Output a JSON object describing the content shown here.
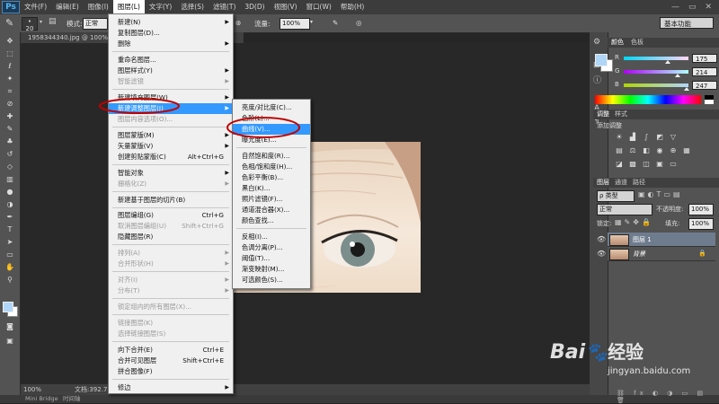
{
  "app": {
    "logo": "Ps"
  },
  "menubar": {
    "items": [
      "文件(F)",
      "编辑(E)",
      "图像(I)",
      "图层(L)",
      "文字(Y)",
      "选择(S)",
      "滤镜(T)",
      "3D(D)",
      "视图(V)",
      "窗口(W)",
      "帮助(H)"
    ],
    "window_buttons": [
      "—",
      "▭",
      "✕"
    ]
  },
  "options_bar": {
    "brush_size": "20",
    "mode_label": "模式:",
    "mode_value": "正常",
    "opacity_label": "不透明度:",
    "opacity_value": "100%",
    "flow_label": "流量:",
    "flow_value": "100%",
    "workspace": "基本功能"
  },
  "document": {
    "tab_title": "1958344340.jpg @ 100% (图层 1, RGB/8) *",
    "status_zoom": "100%",
    "status_doc": "文档:392.7K"
  },
  "bottom_tabs": [
    "Mini Bridge",
    "时间轴"
  ],
  "layer_menu": {
    "items": [
      {
        "label": "新建(N)",
        "arrow": true
      },
      {
        "label": "复制图层(D)..."
      },
      {
        "label": "删除",
        "arrow": true
      },
      {
        "sep": true
      },
      {
        "label": "重命名图层..."
      },
      {
        "label": "图层样式(Y)",
        "arrow": true
      },
      {
        "label": "智能滤镜",
        "disabled": true,
        "arrow": true
      },
      {
        "sep": true
      },
      {
        "label": "新建填充图层(W)",
        "arrow": true
      },
      {
        "label": "新建调整图层(J)",
        "arrow": true,
        "highlight": true
      },
      {
        "label": "图层内容选项(O)...",
        "disabled": true
      },
      {
        "sep": true
      },
      {
        "label": "图层蒙版(M)",
        "arrow": true
      },
      {
        "label": "矢量蒙版(V)",
        "arrow": true
      },
      {
        "label": "创建剪贴蒙版(C)",
        "shortcut": "Alt+Ctrl+G"
      },
      {
        "sep": true
      },
      {
        "label": "智能对象",
        "arrow": true
      },
      {
        "label": "栅格化(Z)",
        "disabled": true,
        "arrow": true
      },
      {
        "sep": true
      },
      {
        "label": "新建基于图层的切片(B)"
      },
      {
        "sep": true
      },
      {
        "label": "图层编组(G)",
        "shortcut": "Ctrl+G"
      },
      {
        "label": "取消图层编组(U)",
        "shortcut": "Shift+Ctrl+G",
        "disabled": true
      },
      {
        "label": "隐藏图层(R)"
      },
      {
        "sep": true
      },
      {
        "label": "排列(A)",
        "disabled": true,
        "arrow": true
      },
      {
        "label": "合并形状(H)",
        "disabled": true,
        "arrow": true
      },
      {
        "sep": true
      },
      {
        "label": "对齐(I)",
        "disabled": true,
        "arrow": true
      },
      {
        "label": "分布(T)",
        "disabled": true,
        "arrow": true
      },
      {
        "sep": true
      },
      {
        "label": "锁定组内的所有图层(X)...",
        "disabled": true
      },
      {
        "sep": true
      },
      {
        "label": "链接图层(K)",
        "disabled": true
      },
      {
        "label": "选择链接图层(S)",
        "disabled": true
      },
      {
        "sep": true
      },
      {
        "label": "向下合并(E)",
        "shortcut": "Ctrl+E"
      },
      {
        "label": "合并可见图层",
        "shortcut": "Shift+Ctrl+E"
      },
      {
        "label": "拼合图像(F)"
      },
      {
        "sep": true
      },
      {
        "label": "修边",
        "arrow": true
      }
    ]
  },
  "adjust_submenu": {
    "items": [
      {
        "label": "亮度/对比度(C)..."
      },
      {
        "label": "色阶(L)..."
      },
      {
        "label": "曲线(V)...",
        "highlight": true
      },
      {
        "label": "曝光度(E)..."
      },
      {
        "sep": true
      },
      {
        "label": "自然饱和度(R)..."
      },
      {
        "label": "色相/饱和度(H)..."
      },
      {
        "label": "色彩平衡(B)..."
      },
      {
        "label": "黑白(K)..."
      },
      {
        "label": "照片滤镜(F)..."
      },
      {
        "label": "通道混合器(X)..."
      },
      {
        "label": "颜色查找..."
      },
      {
        "sep": true
      },
      {
        "label": "反相(I)..."
      },
      {
        "label": "色调分离(P)..."
      },
      {
        "label": "阈值(T)..."
      },
      {
        "label": "渐变映射(M)..."
      },
      {
        "label": "可选颜色(S)..."
      }
    ]
  },
  "color_panel": {
    "tabs": [
      "颜色",
      "色板"
    ],
    "channels": [
      {
        "label": "R",
        "value": "175",
        "fraction": 0.686
      },
      {
        "label": "G",
        "value": "214",
        "fraction": 0.839
      },
      {
        "label": "B",
        "value": "247",
        "fraction": 0.969
      }
    ],
    "fg_color": "#afd6f7"
  },
  "adjust_panel": {
    "tabs": [
      "调整",
      "样式"
    ],
    "title": "添加调整"
  },
  "layers_panel": {
    "tabs": [
      "图层",
      "通道",
      "路径"
    ],
    "kind_label": "ρ 类型",
    "blend": "正常",
    "opacity_label": "不透明度:",
    "opacity_value": "100%",
    "lock_label": "锁定:",
    "fill_label": "填充:",
    "fill_value": "100%",
    "layers": [
      {
        "name": "图层 1",
        "selected": true
      },
      {
        "name": "背景",
        "selected": false
      }
    ]
  },
  "watermark": {
    "brand": "Bai",
    "brand2": "经验",
    "url": "jingyan.baidu.com"
  },
  "colors": {
    "highlight": "#3399ff",
    "annotation": "#c00000"
  }
}
